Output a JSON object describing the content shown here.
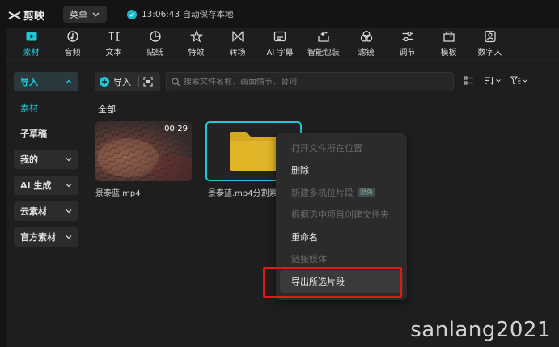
{
  "titlebar": {
    "app_name": "剪映",
    "menu_label": "菜单",
    "save_status": "13:06:43 自动保存本地"
  },
  "toolbar": {
    "items": [
      {
        "label": "素材",
        "icon": "media-icon",
        "active": true
      },
      {
        "label": "音频",
        "icon": "audio-icon"
      },
      {
        "label": "文本",
        "icon": "text-icon"
      },
      {
        "label": "贴纸",
        "icon": "sticker-icon"
      },
      {
        "label": "特效",
        "icon": "effects-icon"
      },
      {
        "label": "转场",
        "icon": "transition-icon"
      },
      {
        "label": "AI 字幕",
        "icon": "ai-caption-icon"
      },
      {
        "label": "智能包装",
        "icon": "smart-pack-icon"
      },
      {
        "label": "滤镜",
        "icon": "filter-icon"
      },
      {
        "label": "调节",
        "icon": "adjust-icon"
      },
      {
        "label": "模板",
        "icon": "template-icon"
      },
      {
        "label": "数字人",
        "icon": "digital-human-icon"
      }
    ]
  },
  "sidebar": {
    "items": [
      {
        "label": "导入"
      },
      {
        "label": "素材"
      },
      {
        "label": "子草稿"
      },
      {
        "label": "我的"
      },
      {
        "label": "AI 生成"
      },
      {
        "label": "云素材"
      },
      {
        "label": "官方素材"
      }
    ]
  },
  "main": {
    "import_label": "导入",
    "search_placeholder": "搜索文件名称、画面情节、台词",
    "section_title": "全部",
    "media": [
      {
        "name": "景泰蓝.mp4",
        "duration": "00:29",
        "type": "video"
      },
      {
        "name": "景泰蓝.mp4分割素材",
        "type": "folder"
      }
    ]
  },
  "context_menu": {
    "items": [
      {
        "label": "打开文件所在位置",
        "enabled": false
      },
      {
        "label": "删除",
        "enabled": true
      },
      {
        "label": "新建多机位片段",
        "enabled": false,
        "badge": "限免"
      },
      {
        "label": "根据选中项目创建文件夹",
        "enabled": false
      },
      {
        "label": "重命名",
        "enabled": true
      },
      {
        "label": "链接媒体",
        "enabled": false
      },
      {
        "label": "导出所选片段",
        "enabled": true,
        "highlighted": true
      }
    ]
  },
  "watermark": "sanlang2021",
  "colors": {
    "accent": "#1fc8d8",
    "highlight_box": "#e01818",
    "folder": "#d4a820"
  }
}
